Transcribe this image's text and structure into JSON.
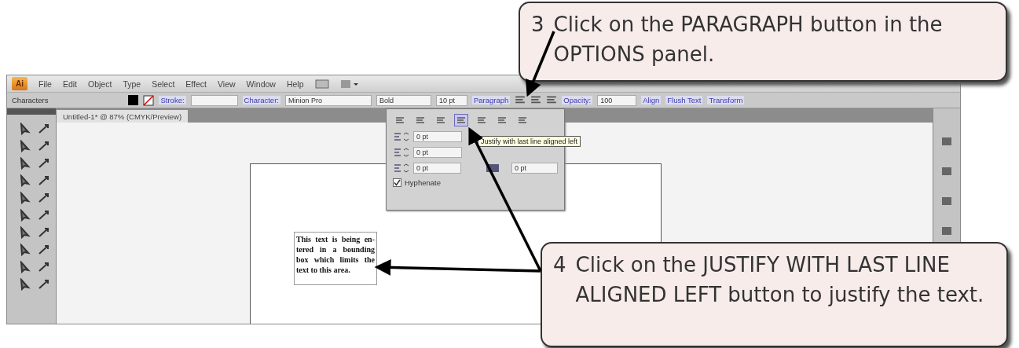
{
  "app": {
    "logo": "Ai",
    "menu": [
      "File",
      "Edit",
      "Object",
      "Type",
      "Select",
      "Effect",
      "View",
      "Window",
      "Help"
    ],
    "control_bar": {
      "mode": "Characters",
      "stroke_label": "Stroke:",
      "character_label": "Character:",
      "font": "Minion Pro",
      "style": "Bold",
      "size": "10 pt",
      "paragraph_label": "Paragraph",
      "opacity_label": "Opacity:",
      "opacity": "100",
      "align_label": "Align",
      "flush_text_label": "Flush Text",
      "transform_label": "Transform"
    },
    "document_tab": "Untitled-1* @ 87% (CMYK/Preview)",
    "paragraph_panel": {
      "align_buttons": [
        {
          "selected": false
        },
        {
          "selected": false
        },
        {
          "selected": false
        },
        {
          "selected": true
        },
        {
          "selected": false
        },
        {
          "selected": false
        },
        {
          "selected": false
        }
      ],
      "left_fields": [
        "0 pt",
        "0 pt",
        "0 pt"
      ],
      "right_field": "0 pt",
      "tooltip": "Justify with last line aligned left",
      "hyphenate": {
        "label": "Hyphenate",
        "checked": true
      }
    },
    "text_lines": [
      "This text is being en-",
      "tered in a bounding",
      "box which limits the",
      "text to this area."
    ]
  },
  "callouts": [
    {
      "number": "3",
      "text": "Click on the PARAGRAPH button in the OPTIONS panel."
    },
    {
      "number": "4",
      "text": "Click on the JUSTIFY WITH LAST LINE ALIGNED LEFT button to justify the text."
    }
  ]
}
